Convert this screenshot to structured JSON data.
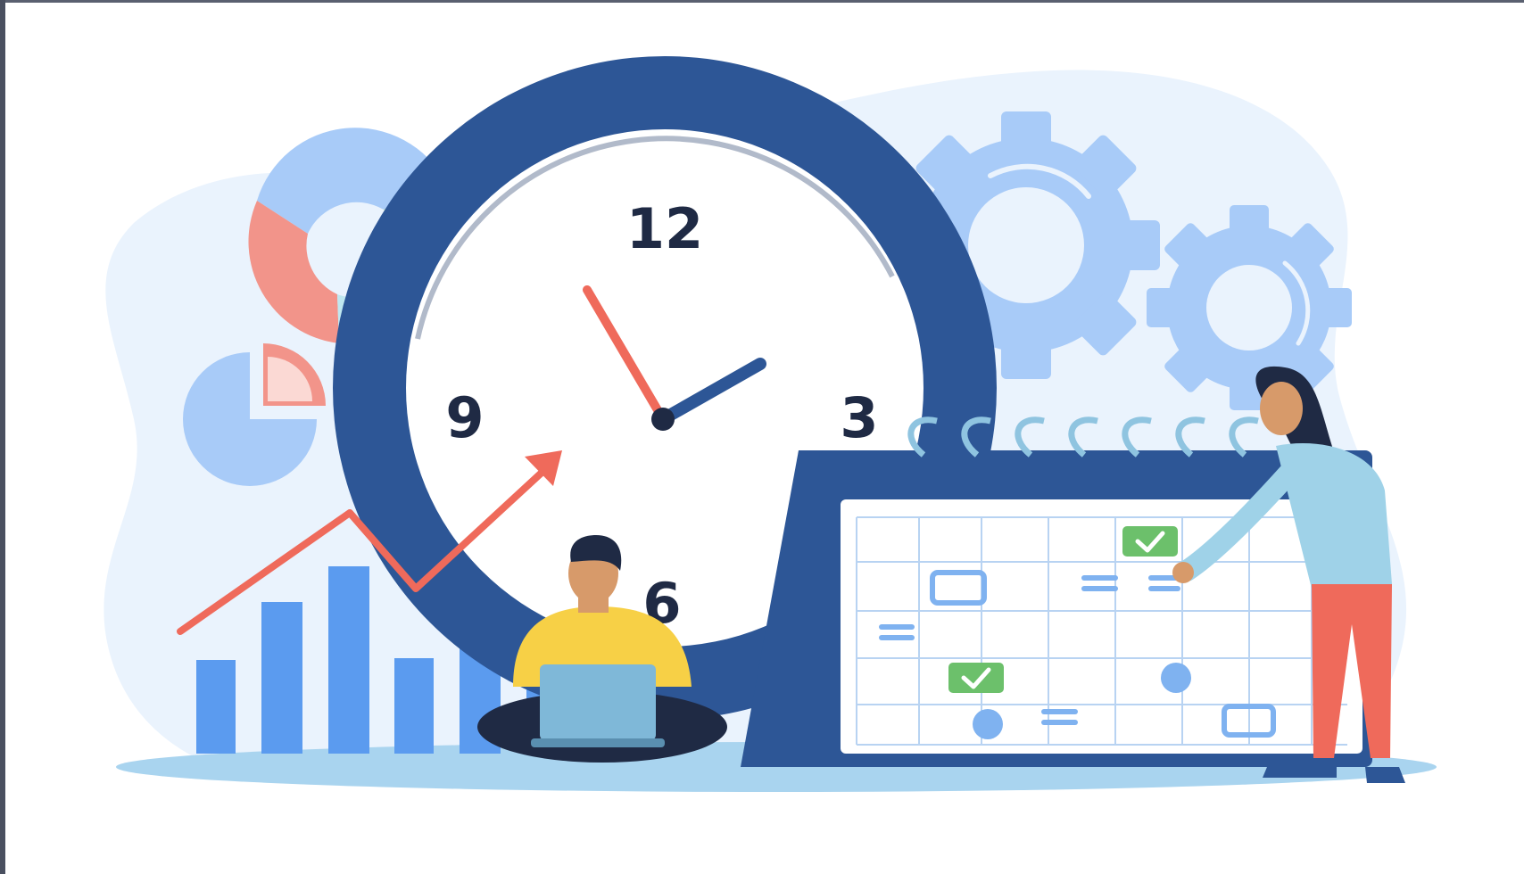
{
  "clock": {
    "numbers": {
      "twelve": "12",
      "three": "3",
      "six": "6",
      "nine": "9"
    }
  },
  "colors": {
    "clock_ring": "#2d5696",
    "accent_red": "#ef6a5b",
    "bar_blue": "#5b9bef",
    "light_blue_bg": "#e8f2fd",
    "gear_blue": "#a8cbf8",
    "shirt_yellow": "#f7d046",
    "pants_red": "#ef6a5b",
    "top_light_blue": "#9fd2e8",
    "check_green": "#6cc06b"
  },
  "icons": [
    "analog-clock-icon",
    "gear-icon",
    "calendar-icon",
    "bar-chart-icon",
    "donut-chart-icon",
    "pie-chart-icon",
    "trend-arrow-icon",
    "laptop-icon",
    "checkmark-icon"
  ]
}
